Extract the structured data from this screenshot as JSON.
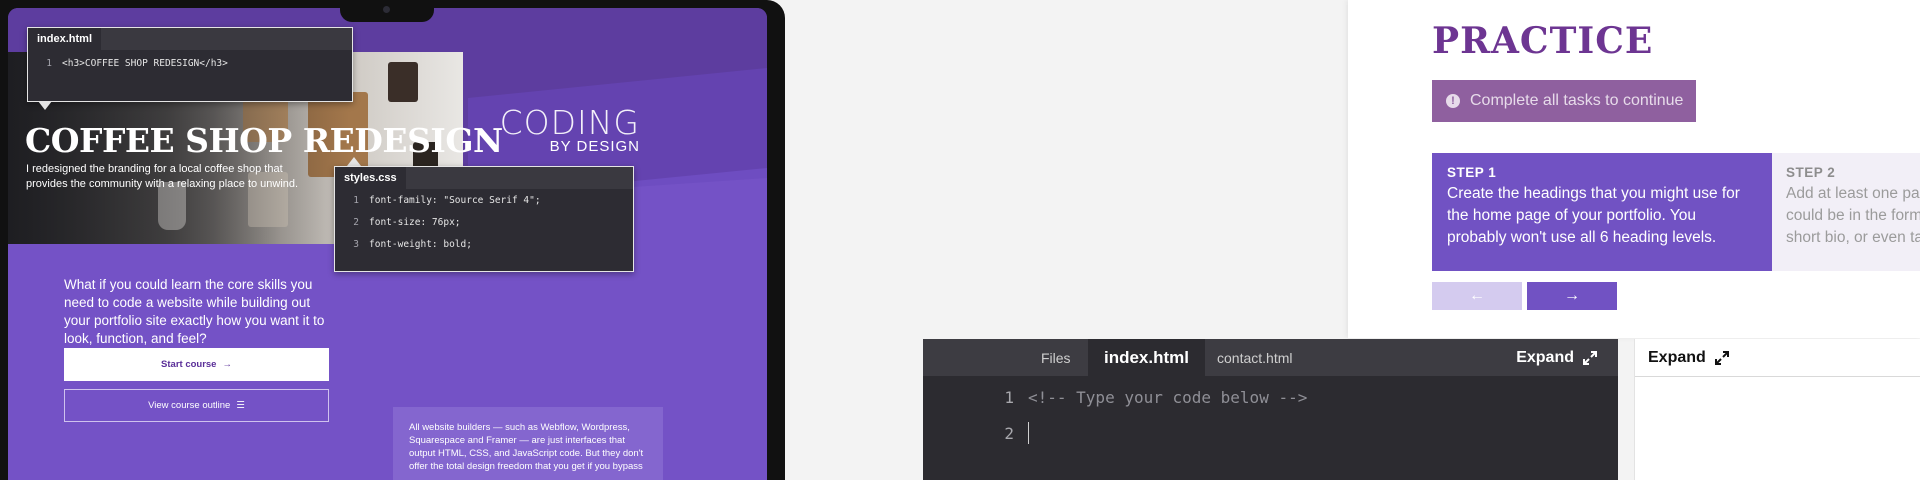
{
  "laptop": {
    "hero": {
      "title": "COFFEE SHOP REDESIGN",
      "subtitle": "I redesigned the  branding for a local coffee shop that provides the community with a relaxing place to unwind."
    },
    "brand": {
      "line1": "CODING",
      "line2": "BY DESIGN"
    },
    "html_panel": {
      "tab": "index.html",
      "lines": [
        {
          "num": "1",
          "code": "<h3>COFFEE SHOP REDESIGN</h3>"
        }
      ]
    },
    "css_panel": {
      "tab": "styles.css",
      "lines": [
        {
          "num": "1",
          "code": "font-family: \"Source Serif 4\";"
        },
        {
          "num": "2",
          "code": "font-size: 76px;"
        },
        {
          "num": "3",
          "code": "font-weight: bold;"
        }
      ]
    },
    "pitch": "What if you could learn the core skills you need to code a website while building out your portfolio site exactly how you want it to look, function, and feel?",
    "start_button": "Start course",
    "outline_button": "View course outline",
    "info_card": "All website builders — such as Webflow, Wordpress, Squarespace and Framer — are just interfaces that output HTML, CSS, and JavaScript code. But they don't offer the total design freedom that you get if you bypass"
  },
  "practice": {
    "title": "PRACTICE",
    "alert": "Complete all tasks to continue",
    "step1": {
      "label": "STEP 1",
      "text": "Create the headings that you might use for the home page of your portfolio. You probably won't use all 6 heading levels."
    },
    "step2": {
      "label": "STEP 2",
      "line1": "Add at least one pa",
      "line2": "could be in the form",
      "line3": "short bio, or even ta"
    },
    "prev_arrow": "←",
    "next_arrow": "→"
  },
  "editor": {
    "tabs": {
      "files": "Files",
      "active": "index.html",
      "contact": "contact.html"
    },
    "expand": "Expand",
    "lines": [
      {
        "num": "1",
        "code": "<!-- Type your code below -->"
      },
      {
        "num": "2",
        "code": ""
      }
    ]
  },
  "preview": {
    "expand": "Expand"
  },
  "colors": {
    "purple": "#7152c3",
    "plum": "#6d3592",
    "editor_bg": "#2c2b30"
  }
}
